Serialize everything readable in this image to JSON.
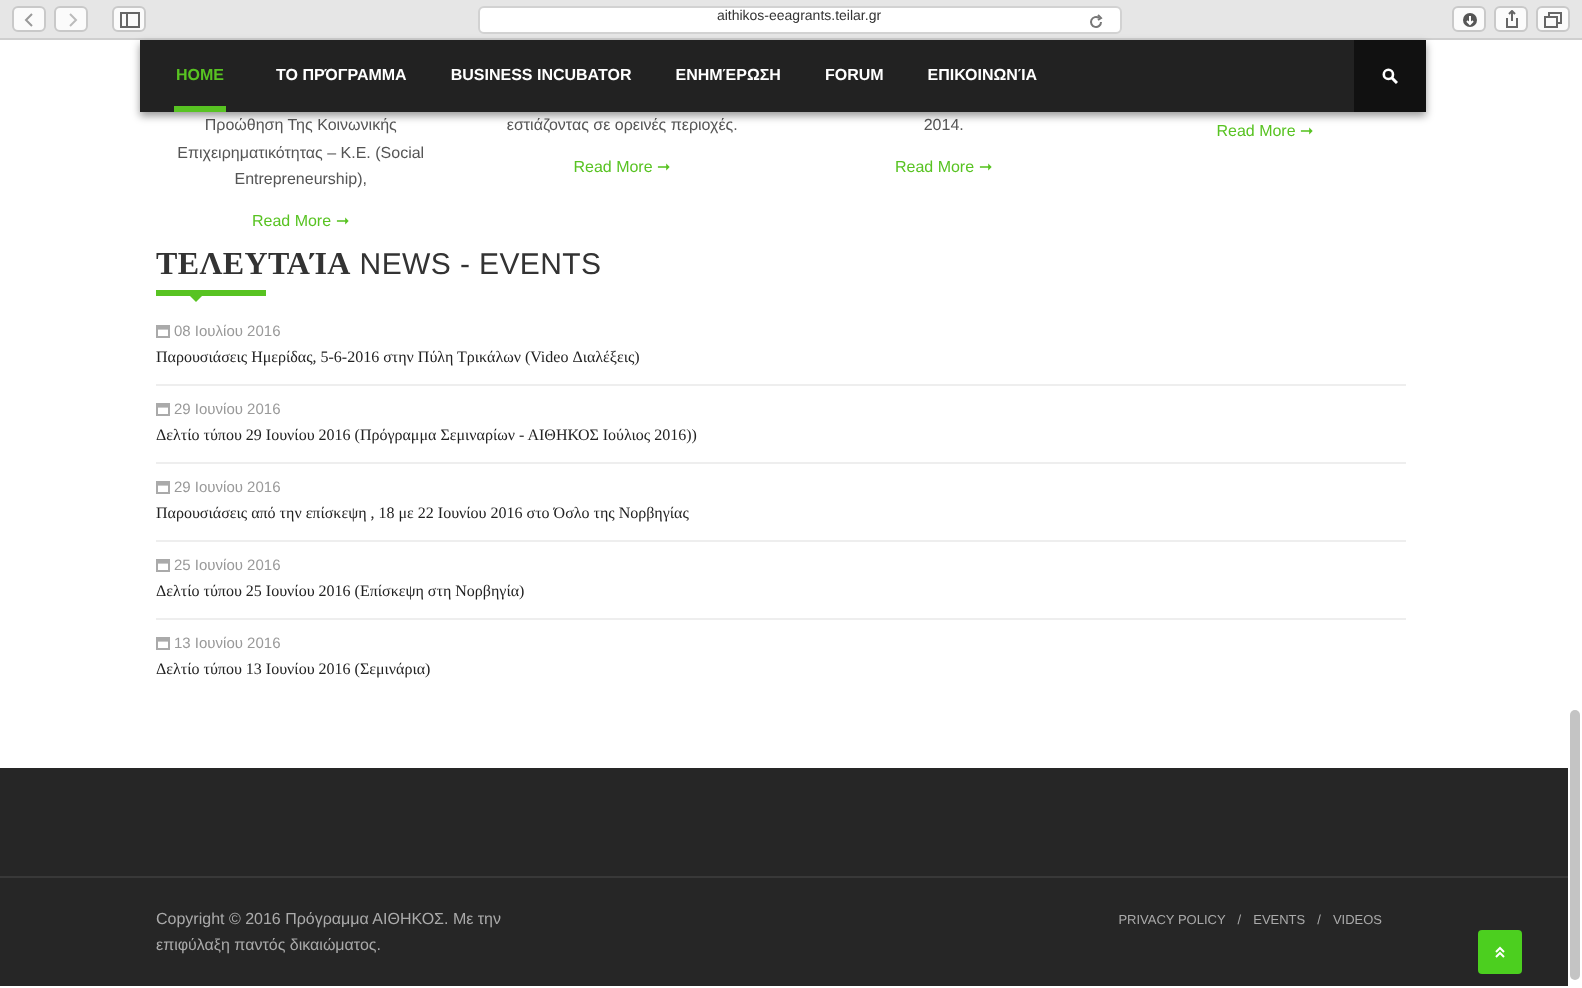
{
  "browser": {
    "url": "aithikos-eeagrants.teilar.gr"
  },
  "nav": {
    "items": [
      {
        "label": "HOME",
        "selected": true
      },
      {
        "label": "ΤΟ ΠΡΌΓΡΑΜΜΑ",
        "selected": false
      },
      {
        "label": "BUSINESS INCUBATOR",
        "selected": false
      },
      {
        "label": "ΕΝΗΜΈΡΩΣΗ",
        "selected": false
      },
      {
        "label": "FORUM",
        "selected": false
      },
      {
        "label": "ΕΠΙΚΟΙΝΩΝΊΑ",
        "selected": false
      }
    ]
  },
  "columns": [
    {
      "text": "Προώθηση Της Κοινωνικής Επιχειρηματικότητας – Κ.Ε. (Social Entrepreneurship),",
      "link": "Read More ➞"
    },
    {
      "text": "εστιάζοντας σε ορεινές περιοχές.",
      "link": "Read More ➞"
    },
    {
      "text": "2014.",
      "link": "Read More ➞"
    },
    {
      "link": "Read More ➞"
    }
  ],
  "news": {
    "heading": "**ΤΕΛΕΥΤΑΊΑ** NEWS - EVENTS",
    "items": [
      {
        "date": "08 Ιουλίου 2016",
        "title": "Παρουσιάσεις Ημερίδας, 5-6-2016 στην Πύλη Τρικάλων (Video Διαλέξεις)"
      },
      {
        "date": "29 Ιουνίου 2016",
        "title": "Δελτίο τύπου 29 Ιουνίου 2016 (Πρόγραμμα Σεμιναρίων - ΑΙΘΗΚΟΣ Ιούλιος 2016))"
      },
      {
        "date": "29 Ιουνίου 2016",
        "title": "Παρουσιάσεις από την επίσκεψη , 18 με 22 Ιουνίου 2016 στο Όσλο της Νορβηγίας"
      },
      {
        "date": "25 Ιουνίου 2016",
        "title": "Δελτίο τύπου 25 Ιουνίου 2016 (Επίσκεψη στη Νορβηγία)"
      },
      {
        "date": "13 Ιουνίου 2016",
        "title": "Δελτίο τύπου 13 Ιουνίου 2016 (Σεμινάρια)"
      }
    ]
  },
  "footer": {
    "copyright": "Copyright © 2016 Πρόγραμμα ΑΙΘΗΚΟΣ. Με την επιφύλαξη παντός δικαιώματος.",
    "links": [
      "PRIVACY POLICY",
      "EVENTS",
      "VIDEOS"
    ],
    "separator": "/"
  }
}
